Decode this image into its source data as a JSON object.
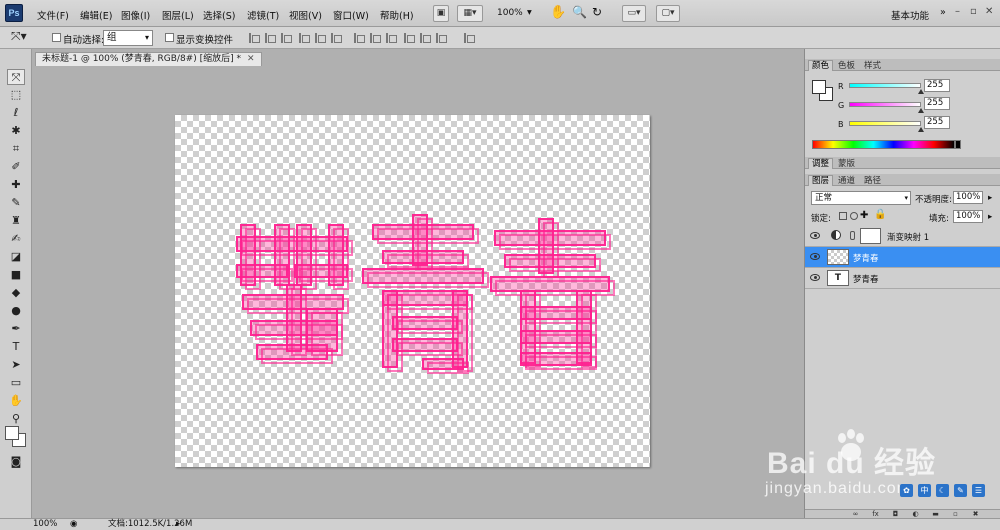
{
  "app": {
    "logo": "Ps"
  },
  "menu": [
    {
      "id": "file",
      "label": "文件(F)"
    },
    {
      "id": "edit",
      "label": "编辑(E)"
    },
    {
      "id": "image",
      "label": "图像(I)"
    },
    {
      "id": "layer",
      "label": "图层(L)"
    },
    {
      "id": "select",
      "label": "选择(S)"
    },
    {
      "id": "filter",
      "label": "滤镜(T)"
    },
    {
      "id": "view",
      "label": "视图(V)"
    },
    {
      "id": "window",
      "label": "窗口(W)"
    },
    {
      "id": "help",
      "label": "帮助(H)"
    }
  ],
  "appbar": {
    "zoom": "100%",
    "workspace": "基本功能"
  },
  "options": {
    "auto_select_label": "自动选择:",
    "auto_select_value": "组",
    "show_transform_label": "显示变换控件"
  },
  "document": {
    "tab_title": "未标题-1 @ 100% (梦青春, RGB/8#) [缩放后] *",
    "art_text": "梦青春",
    "art_color": "#ff1f8f"
  },
  "status": {
    "zoom": "100%",
    "doc_info": "文档:1012.5K/1.26M"
  },
  "color_panel": {
    "tabs": [
      "颜色",
      "色板",
      "样式"
    ],
    "channels": [
      {
        "name": "R",
        "value": "255",
        "fraction": 1.0
      },
      {
        "name": "G",
        "value": "255",
        "fraction": 1.0
      },
      {
        "name": "B",
        "value": "255",
        "fraction": 1.0
      }
    ]
  },
  "adjust_panel": {
    "tabs": [
      "调整",
      "蒙版"
    ]
  },
  "layers_panel": {
    "tabs": [
      "图层",
      "通道",
      "路径"
    ],
    "blend_mode": "正常",
    "opacity_label": "不透明度:",
    "opacity": "100%",
    "lock_label": "锁定:",
    "fill_label": "填充:",
    "fill": "100%",
    "layers": [
      {
        "name": "渐变映射 1",
        "type": "adjustment",
        "selected": false
      },
      {
        "name": "梦青春",
        "type": "pixel",
        "selected": true
      },
      {
        "name": "梦青春",
        "type": "text",
        "selected": false,
        "thumb": "T"
      }
    ]
  },
  "watermark": {
    "logo": "Bai du 经验",
    "url": "jingyan.baidu.com"
  },
  "bottom_icons": [
    "中",
    "✎",
    "☰"
  ]
}
